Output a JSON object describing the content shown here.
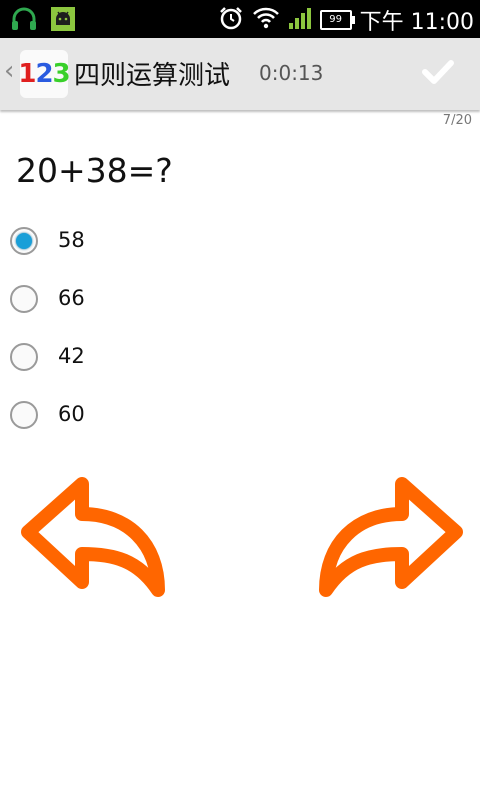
{
  "status_bar": {
    "time": "下午 11:00",
    "battery_level": "99",
    "left_icons": [
      "headphones-icon",
      "android-icon"
    ],
    "right_icons": [
      "alarm-icon",
      "wifi-icon",
      "signal-icon",
      "battery-icon"
    ]
  },
  "action_bar": {
    "icon_digits": [
      "1",
      "2",
      "3"
    ],
    "title": "四则运算测试",
    "timer": "0:0:13",
    "submit_icon": "check-icon"
  },
  "quiz": {
    "progress": "7/20",
    "question": "20+38=?",
    "options": [
      {
        "label": "58",
        "selected": true
      },
      {
        "label": "66",
        "selected": false
      },
      {
        "label": "42",
        "selected": false
      },
      {
        "label": "60",
        "selected": false
      }
    ]
  },
  "navigation": {
    "prev_icon": "back-arrow-icon",
    "next_icon": "forward-arrow-icon",
    "arrow_color": "#ff6600"
  },
  "colors": {
    "accent": "#199fd8",
    "action_bar_bg": "#e6e6e6",
    "status_bar_bg": "#000000"
  }
}
